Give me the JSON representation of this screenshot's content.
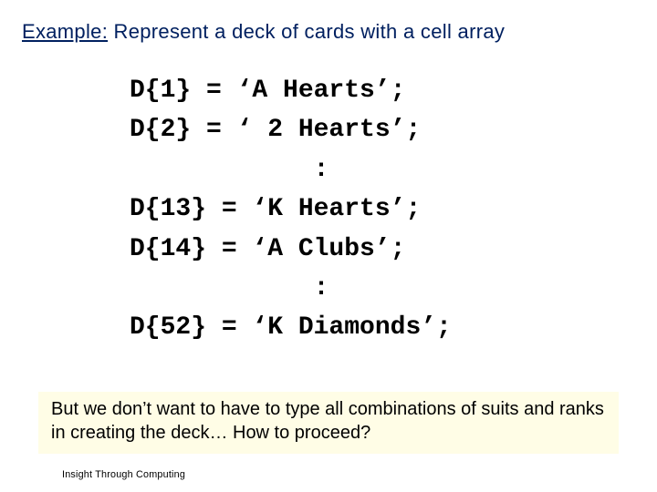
{
  "title": {
    "prefix": "Example:",
    "rest": " Represent a deck of cards with a cell array"
  },
  "code": {
    "l1": "D{1} = ‘A Hearts’;",
    "l2": "D{2} = ‘ 2 Hearts’;",
    "l3": "            :",
    "l4": "D{13} = ‘K Hearts’;",
    "l5": "D{14} = ‘A Clubs’;",
    "l6": "            :",
    "l7": "D{52} = ‘K Diamonds’;"
  },
  "note": "But we don’t want to have to type all combinations of suits and ranks in creating the deck… How to proceed?",
  "footer": "Insight Through Computing"
}
